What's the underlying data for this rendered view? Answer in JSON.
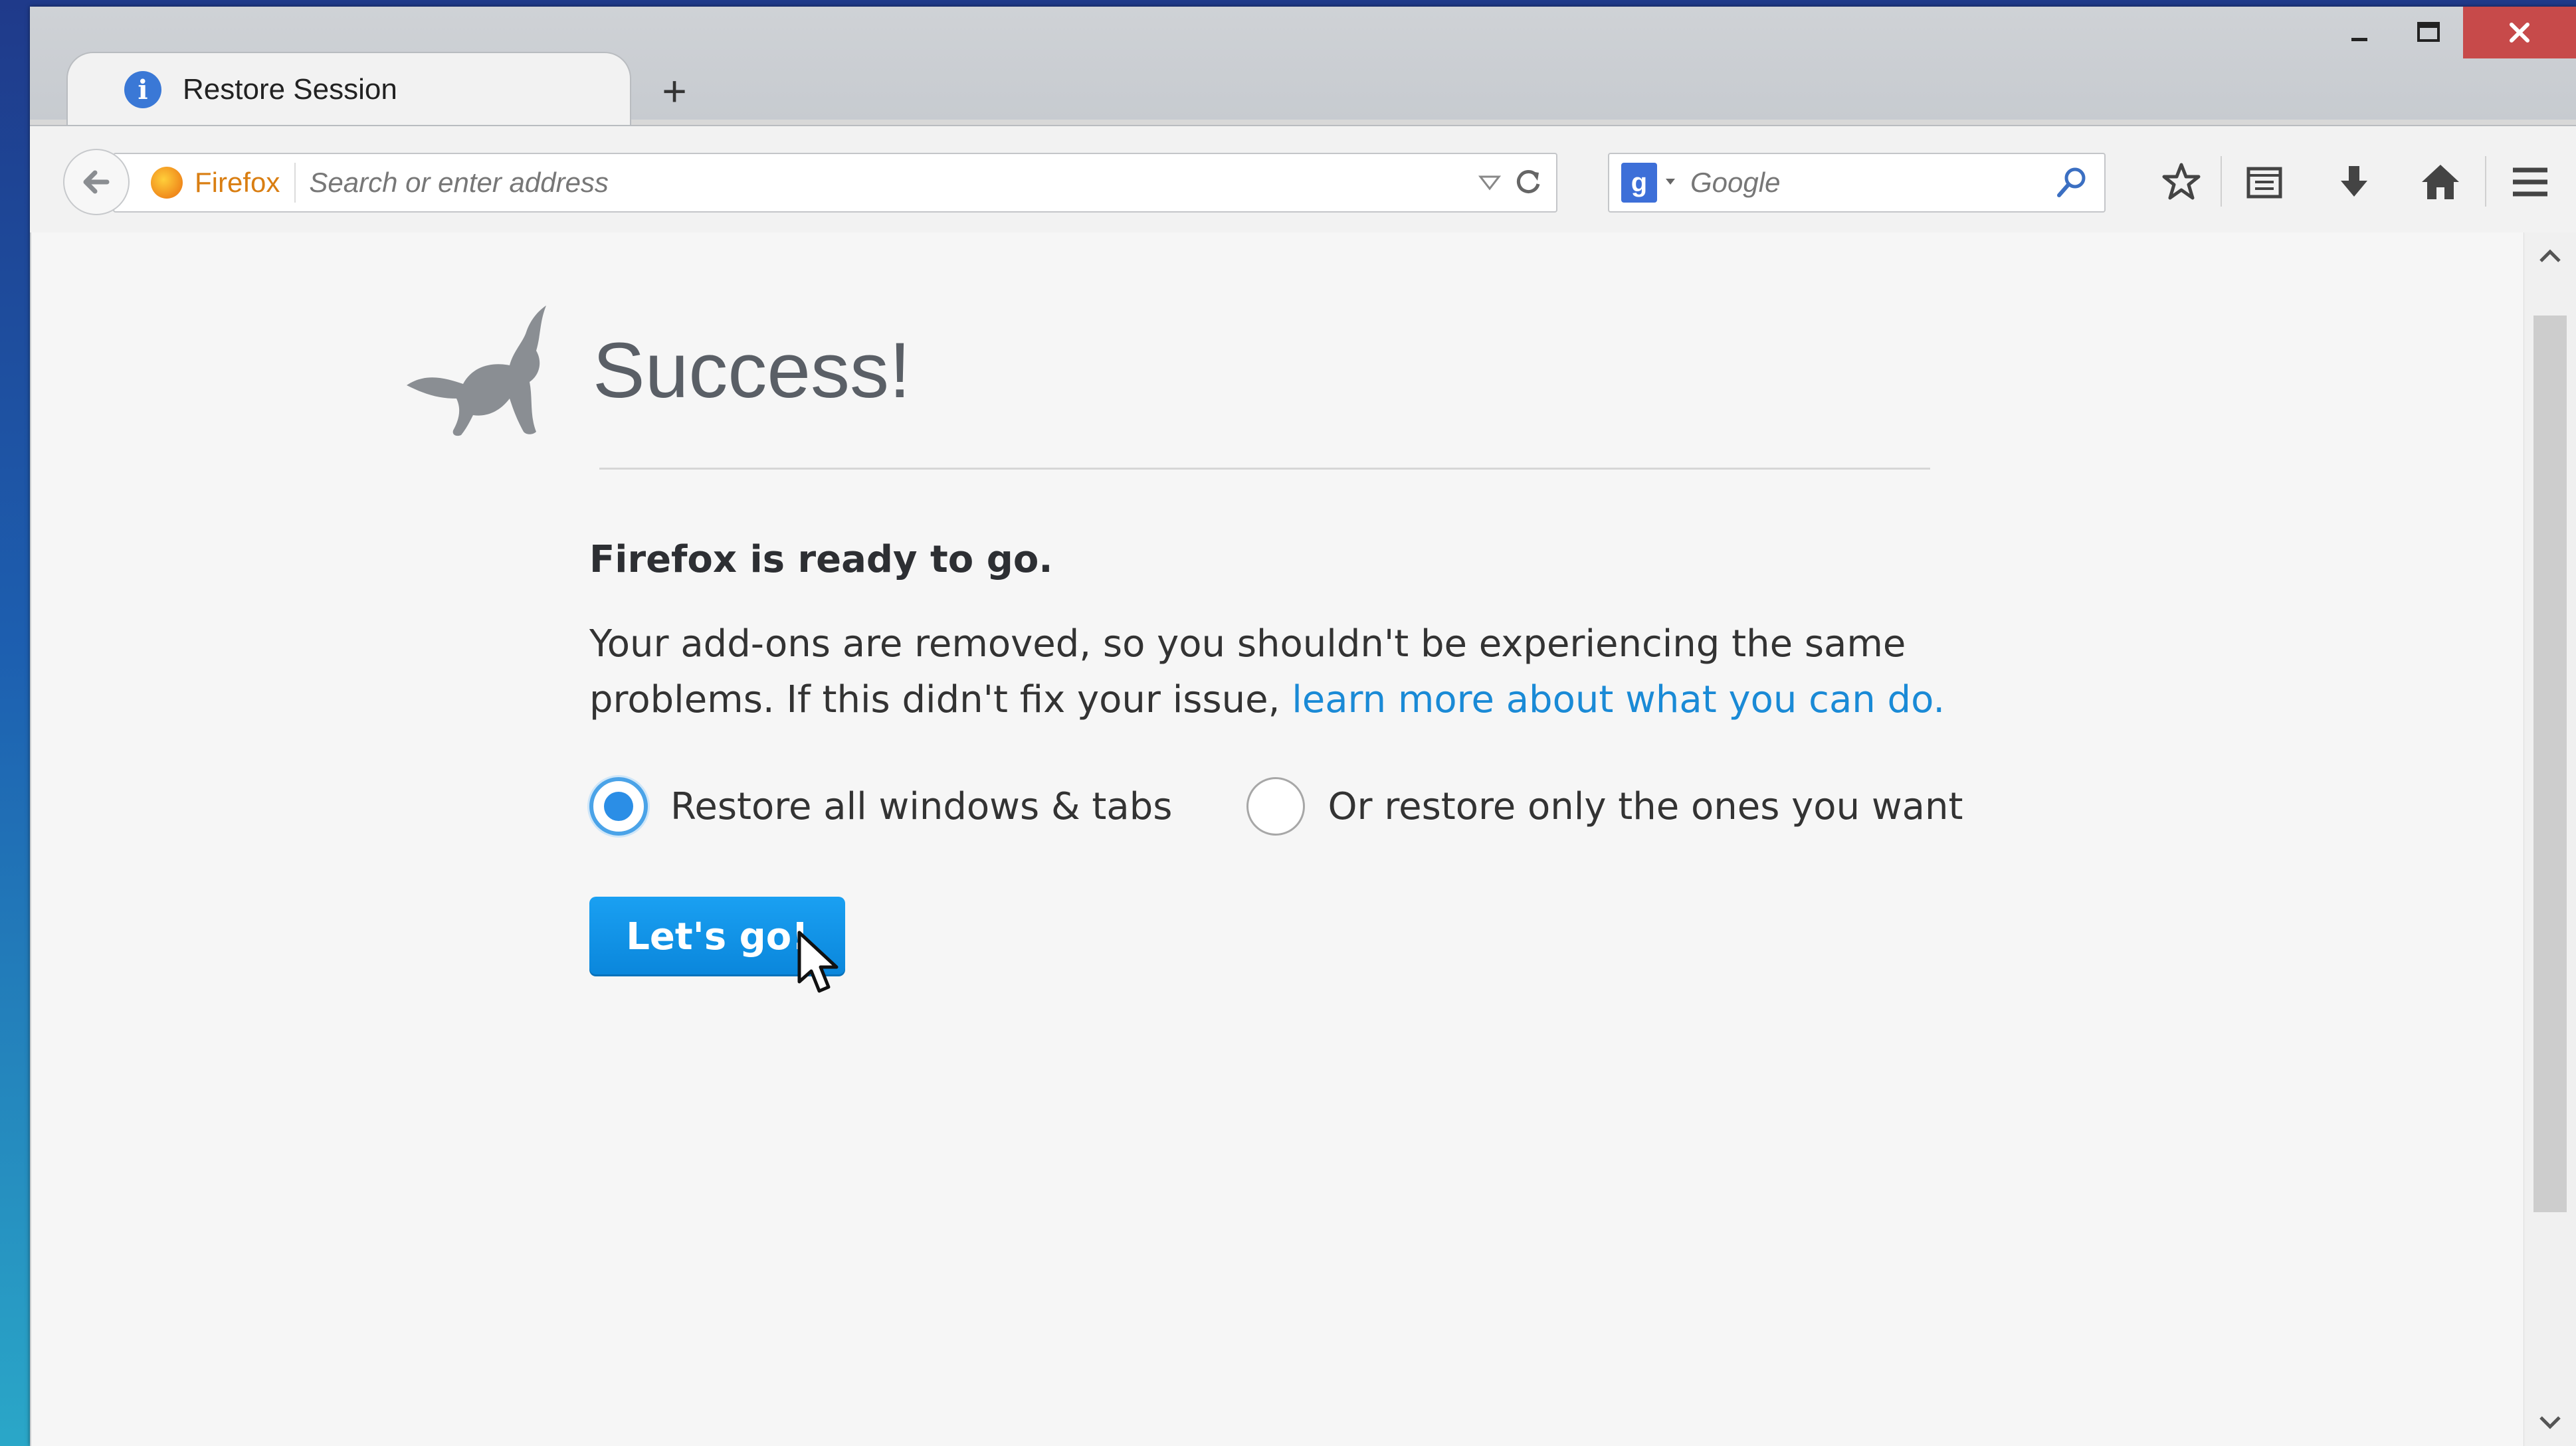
{
  "tab": {
    "title": "Restore Session",
    "icon": "info-icon",
    "icon_glyph": "i",
    "new_tab_glyph": "+"
  },
  "window_controls": {
    "minimize": "minimize-icon",
    "maximize": "maximize-icon",
    "close": "close-icon"
  },
  "navbar": {
    "identity_label": "Firefox",
    "url_placeholder": "Search or enter address",
    "search_engine_glyph": "g",
    "search_placeholder": "Google"
  },
  "content": {
    "heading": "Success!",
    "lead": "Firefox is ready to go.",
    "body_prefix": "Your add-ons are removed, so you shouldn't be experiencing the same problems. If this didn't fix your issue, ",
    "body_link": "learn more about what you can do.",
    "options": [
      {
        "label": "Restore all windows & tabs",
        "checked": true
      },
      {
        "label": "Or restore only the ones you want",
        "checked": false
      }
    ],
    "button_label": "Let's go!"
  },
  "colors": {
    "accent": "#0a86db",
    "link": "#1a8ad6",
    "close_button": "#c74a4a",
    "identity": "#d97e12"
  }
}
